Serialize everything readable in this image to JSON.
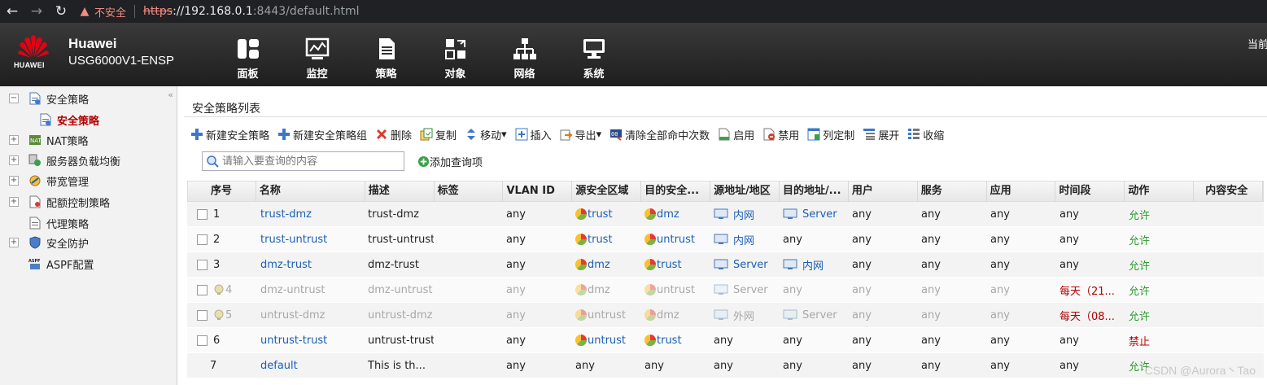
{
  "browser": {
    "insecure_label": "不安全",
    "url_scheme": "https",
    "url_host": "://192.168.0.1",
    "url_rest": ":8443/default.html"
  },
  "header": {
    "logo_text": "HUAWEI",
    "brand_name": "Huawei",
    "model": "USG6000V1-ENSP",
    "nav": [
      {
        "label": "面板",
        "icon": "dashboard-icon"
      },
      {
        "label": "监控",
        "icon": "monitor-icon"
      },
      {
        "label": "策略",
        "icon": "policy-icon"
      },
      {
        "label": "对象",
        "icon": "object-icon"
      },
      {
        "label": "网络",
        "icon": "network-icon"
      },
      {
        "label": "系统",
        "icon": "system-icon"
      }
    ],
    "right_text": "当前"
  },
  "sidebar": {
    "items": [
      {
        "label": "安全策略",
        "expander": "−"
      },
      {
        "label": "安全策略",
        "selected": true
      },
      {
        "label": "NAT策略",
        "expander": "+"
      },
      {
        "label": "服务器负载均衡",
        "expander": "+"
      },
      {
        "label": "带宽管理",
        "expander": "+"
      },
      {
        "label": "配额控制策略",
        "expander": "+"
      },
      {
        "label": "代理策略",
        "expander": ""
      },
      {
        "label": "安全防护",
        "expander": "+"
      },
      {
        "label": "ASPF配置",
        "expander": ""
      }
    ]
  },
  "panel": {
    "title": "安全策略列表"
  },
  "toolbar": {
    "new_policy": "新建安全策略",
    "new_group": "新建安全策略组",
    "delete": "删除",
    "copy": "复制",
    "move": "移动",
    "insert": "插入",
    "export": "导出",
    "clear_hits": "清除全部命中次数",
    "enable": "启用",
    "disable": "禁用",
    "customize_columns": "列定制",
    "expand": "展开",
    "collapse": "收缩"
  },
  "search": {
    "placeholder": "请输入要查询的内容",
    "add_query": "添加查询项"
  },
  "table": {
    "headers": [
      "序号",
      "名称",
      "描述",
      "标签",
      "VLAN ID",
      "源安全区域",
      "目的安全...",
      "源地址/地区",
      "目的地址/...",
      "用户",
      "服务",
      "应用",
      "时间段",
      "动作",
      "内容安全"
    ],
    "rows": [
      {
        "no": "1",
        "name": "trust-dmz",
        "desc": "trust-dmz",
        "tag": "",
        "vlan": "any",
        "src_zone": "trust",
        "dst_zone": "dmz",
        "src_addr": "内网",
        "dst_addr": "Server",
        "user": "any",
        "service": "any",
        "app": "any",
        "time": "any",
        "action": "允许",
        "content": ""
      },
      {
        "no": "2",
        "name": "trust-untrust",
        "desc": "trust-untrust",
        "tag": "",
        "vlan": "any",
        "src_zone": "trust",
        "dst_zone": "untrust",
        "src_addr": "内网",
        "dst_addr": "any",
        "user": "any",
        "service": "any",
        "app": "any",
        "time": "any",
        "action": "允许",
        "content": ""
      },
      {
        "no": "3",
        "name": "dmz-trust",
        "desc": "dmz-trust",
        "tag": "",
        "vlan": "any",
        "src_zone": "dmz",
        "dst_zone": "trust",
        "src_addr": "Server",
        "dst_addr": "内网",
        "user": "any",
        "service": "any",
        "app": "any",
        "time": "any",
        "action": "允许",
        "content": ""
      },
      {
        "no": "4",
        "name": "dmz-untrust",
        "desc": "dmz-untrust",
        "tag": "",
        "vlan": "any",
        "src_zone": "dmz",
        "dst_zone": "untrust",
        "src_addr": "Server",
        "dst_addr": "any",
        "user": "any",
        "service": "any",
        "app": "any",
        "time": "每天（21...",
        "action": "允许",
        "content": ""
      },
      {
        "no": "5",
        "name": "untrust-dmz",
        "desc": "untrust-dmz",
        "tag": "",
        "vlan": "any",
        "src_zone": "untrust",
        "dst_zone": "dmz",
        "src_addr": "外网",
        "dst_addr": "Server",
        "user": "any",
        "service": "any",
        "app": "any",
        "time": "每天（08...",
        "action": "允许",
        "content": ""
      },
      {
        "no": "6",
        "name": "untrust-trust",
        "desc": "untrust-trust",
        "tag": "",
        "vlan": "any",
        "src_zone": "untrust",
        "dst_zone": "trust",
        "src_addr": "any",
        "dst_addr": "any",
        "user": "any",
        "service": "any",
        "app": "any",
        "time": "any",
        "action": "禁止",
        "content": ""
      },
      {
        "no": "7",
        "name": "default",
        "desc": "This is th...",
        "tag": "",
        "vlan": "any",
        "src_zone": "any",
        "dst_zone": "any",
        "src_addr": "any",
        "dst_addr": "any",
        "user": "any",
        "service": "any",
        "app": "any",
        "time": "any",
        "action": "允许",
        "content": ""
      }
    ]
  },
  "watermark": "CSDN @Aurora丶Tao"
}
